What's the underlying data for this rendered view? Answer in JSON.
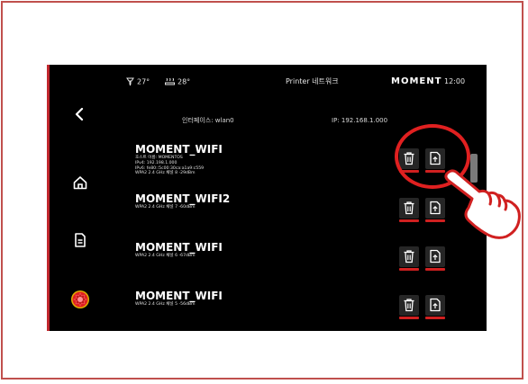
{
  "status": {
    "temp_nozzle": "27°",
    "temp_bed": "28°",
    "title": "Printer 네트워크",
    "brand": "MOMENT",
    "time": "12:00"
  },
  "info": {
    "interface": "인터페이스: wlan0",
    "ip": "IP: 192.168.1.000"
  },
  "networks": [
    {
      "name": "MOMENT_WIFI",
      "details": [
        "호스트 이름: MOMENTOS",
        "IPv4: 192.198.1.000",
        "IPv6: fe80::5c00:30ca:a1a9:c559",
        "WPA2 2.4 GHz 채널 8 -29dBm"
      ]
    },
    {
      "name": "MOMENT_WIFI2",
      "details": [
        "WPA2 2.4 GHz 채널 7 -60dBm"
      ]
    },
    {
      "name": "MOMENT_WIFI",
      "details": [
        "WPA2 2.4 GHz 채널 6 -67dBm"
      ]
    },
    {
      "name": "MOMENT_WIFI",
      "details": [
        "WPA2 2.4 GHz 채널 5 -56dBm"
      ]
    }
  ],
  "colors": {
    "accent": "#d02020",
    "callout": "#e02020",
    "frame": "#c0504d"
  }
}
